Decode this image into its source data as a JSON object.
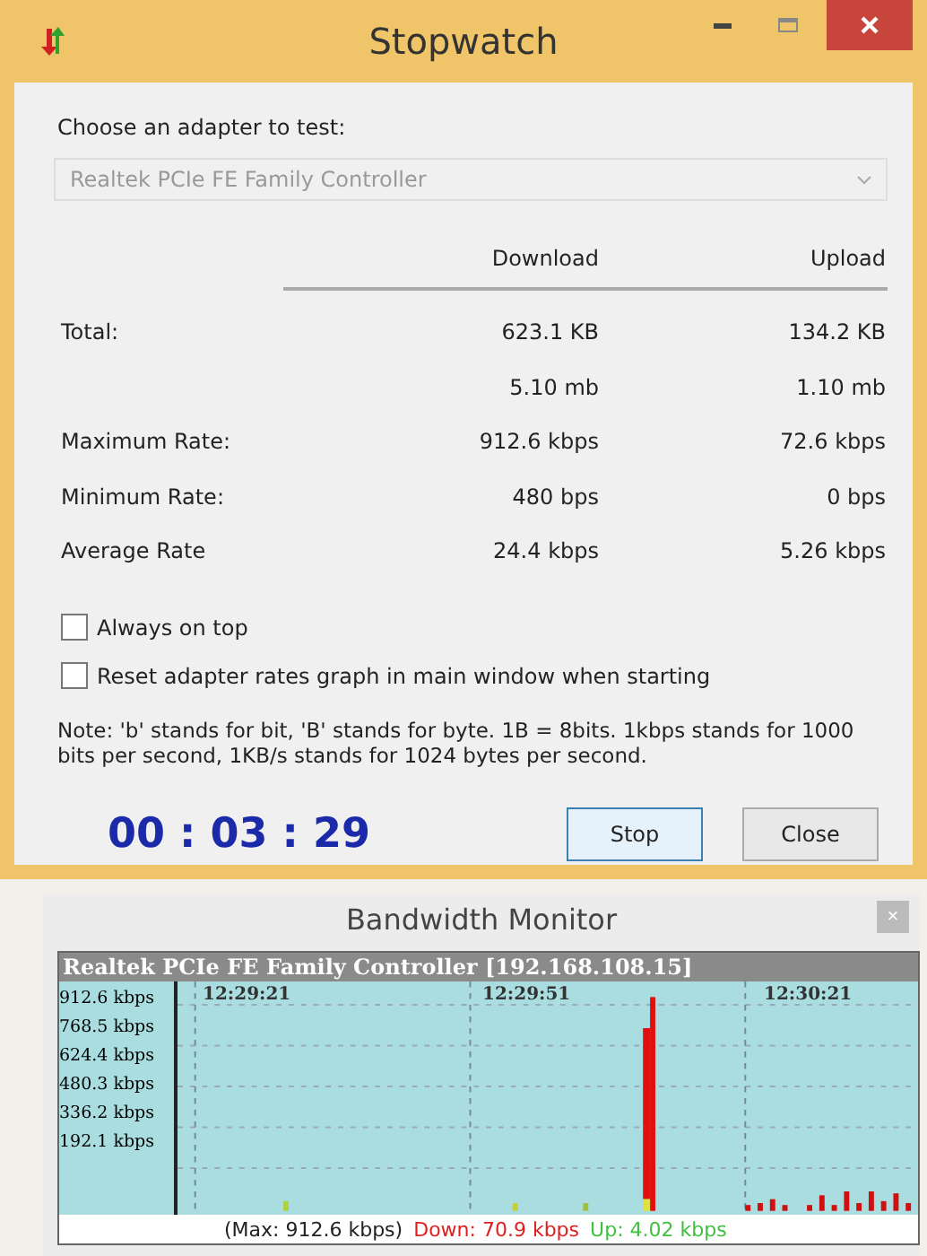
{
  "window": {
    "title": "Stopwatch"
  },
  "adapter": {
    "label": "Choose an adapter to test:",
    "value": "Realtek PCIe FE Family Controller",
    "disabled": true
  },
  "stats": {
    "columns": [
      "Download",
      "Upload"
    ],
    "rows": [
      {
        "label": "Total:",
        "download": "623.1 KB",
        "upload": "134.2 KB"
      },
      {
        "label": "",
        "download": "5.10 mb",
        "upload": "1.10 mb"
      },
      {
        "label": "Maximum Rate:",
        "download": "912.6 kbps",
        "upload": "72.6 kbps"
      },
      {
        "label": "Minimum Rate:",
        "download": "480 bps",
        "upload": "0 bps"
      },
      {
        "label": "Average Rate",
        "download": "24.4 kbps",
        "upload": "5.26 kbps"
      }
    ]
  },
  "options": [
    {
      "label": "Always on top",
      "checked": false
    },
    {
      "label": "Reset adapter rates graph in main window when starting",
      "checked": false
    }
  ],
  "note": "Note: 'b' stands for bit, 'B' stands for byte. 1B = 8bits. 1kbps stands for 1000 bits per second, 1KB/s stands for 1024 bytes per second.",
  "timer": "00 : 03 : 29",
  "buttons": [
    "Stop",
    "Close"
  ],
  "monitor": {
    "title": "Bandwidth Monitor",
    "close": "×",
    "graph_title": "Realtek PCIe FE Family Controller [192.168.108.15]",
    "y_labels": [
      "912.6 kbps",
      "768.5 kbps",
      "624.4 kbps",
      "480.3 kbps",
      "336.2 kbps",
      "192.1 kbps"
    ],
    "x_labels": [
      "12:29:21",
      "12:29:51",
      "12:30:21"
    ],
    "footer": [
      {
        "kind": "max",
        "text": "(Max: 912.6 kbps)"
      },
      {
        "kind": "down",
        "text": "Down: 70.9 kbps"
      },
      {
        "kind": "up",
        "text": "Up: 4.02 kbps"
      }
    ]
  }
}
